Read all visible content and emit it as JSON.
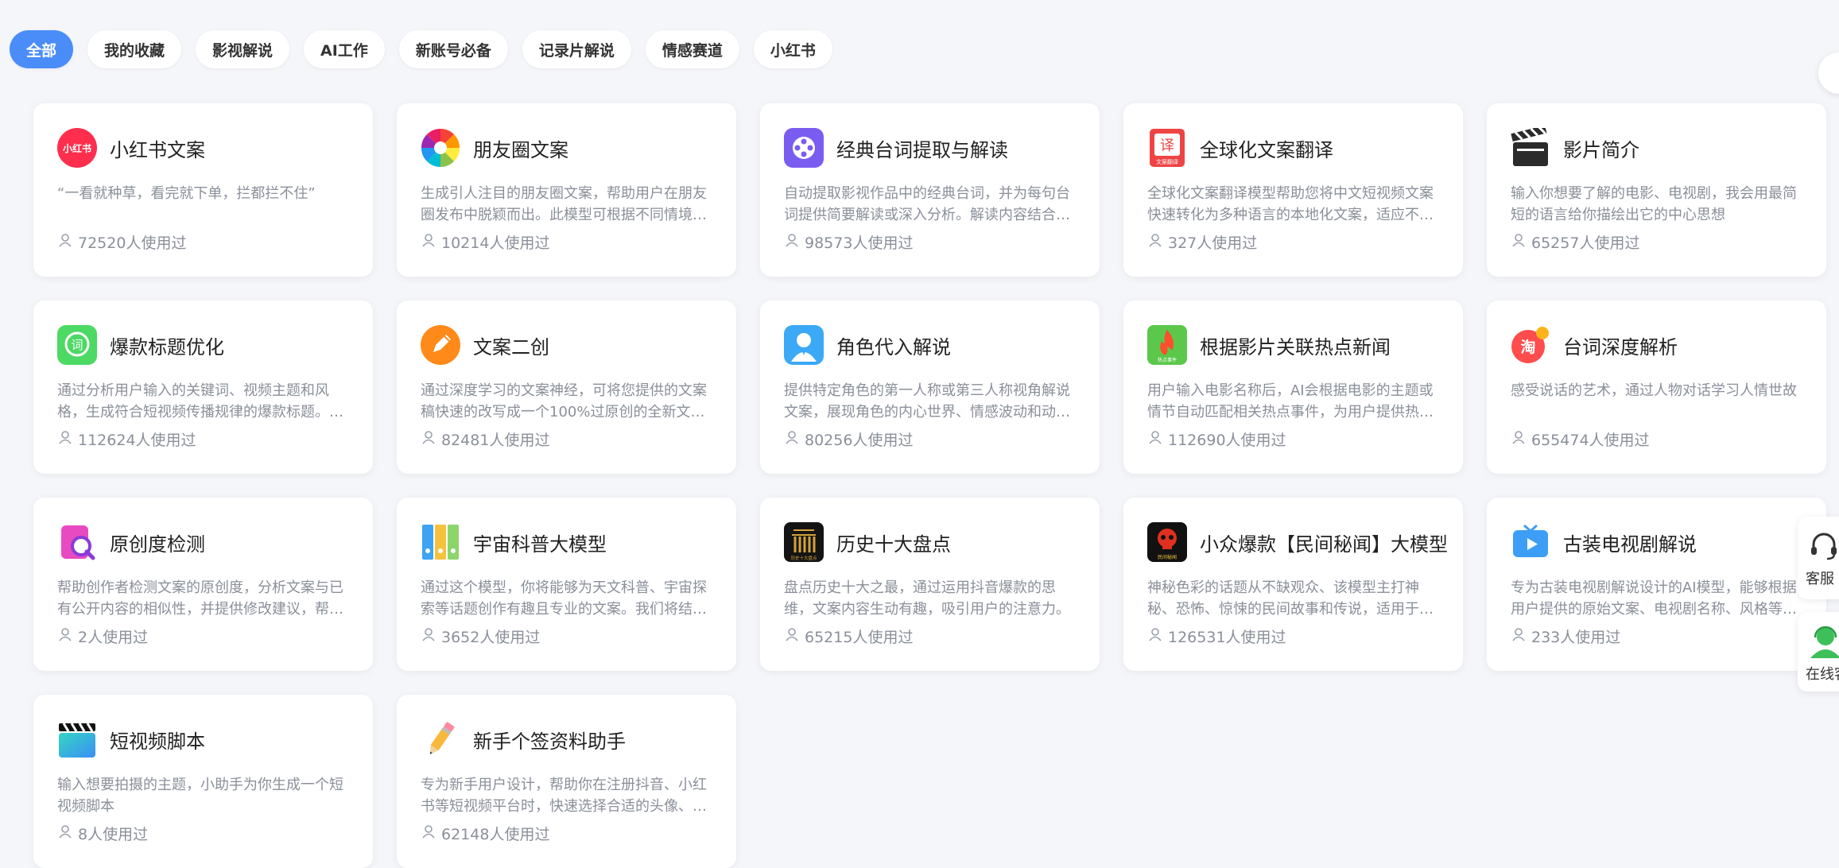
{
  "tabs": [
    "全部",
    "我的收藏",
    "影视解说",
    "AI工作",
    "新账号必备",
    "记录片解说",
    "情感赛道",
    "小红书"
  ],
  "usage_suffix": "人使用过",
  "cards": [
    {
      "title": "小红书文案",
      "desc": "“一看就种草，看完就下单，拦都拦不住”",
      "usage": "72520人使用过",
      "icon": "xiaohongshu-logo-icon",
      "icon_text": "小红书"
    },
    {
      "title": "朋友圈文案",
      "desc": "生成引人注目的朋友圈文案，帮助用户在朋友圈发布中脱颖而出。此模型可根据不同情境和主题，创作出富有创意和吸引力的文案。",
      "usage": "10214人使用过",
      "icon": "camera-aperture-icon"
    },
    {
      "title": "经典台词提取与解读",
      "desc": "自动提取影视作品中的经典台词，并为每句台词提供简要解读或深入分析。解读内容结合剧情与人物背景。",
      "usage": "98573人使用过",
      "icon": "film-reel-icon"
    },
    {
      "title": "全球化文案翻译",
      "desc": "全球化文案翻译模型帮助您将中文短视频文案快速转化为多种语言的本地化文案，适应不同地区受众。",
      "usage": "327人使用过",
      "icon": "translate-book-icon",
      "icon_text": "译",
      "icon_sub": "文案翻译"
    },
    {
      "title": "影片简介",
      "desc": "输入你想要了解的电影、电视剧，我会用最简短的语言给你描绘出它的中心思想",
      "usage": "65257人使用过",
      "icon": "clapperboard-icon"
    },
    {
      "title": "爆款标题优化",
      "desc": "通过分析用户输入的关键词、视频主题和风格，生成符合短视频传播规律的爆款标题。标题更具吸引力。",
      "usage": "112624人使用过",
      "icon": "word-bubble-icon",
      "icon_text": "词"
    },
    {
      "title": "文案二创",
      "desc": "通过深度学习的文案神经，可将您提供的文案稿快速的改写成一个100%过原创的全新文案，保持原意不变。",
      "usage": "82481人使用过",
      "icon": "pencil-circle-icon"
    },
    {
      "title": "角色代入解说",
      "desc": "提供特定角色的第一人称或第三人称视角解说文案，展现角色的内心世界、情感波动和动机变化。",
      "usage": "80256人使用过",
      "icon": "person-avatar-icon"
    },
    {
      "title": "根据影片关联热点新闻",
      "desc": "用户输入电影名称后，AI会根据电影的主题或情节自动匹配相关热点事件，为用户提供热点解说思路。",
      "usage": "112690人使用过",
      "icon": "hot-news-flame-icon",
      "icon_sub": "热点事件"
    },
    {
      "title": "台词深度解析",
      "desc": "感受说话的艺术，通过人物对话学习人情世故",
      "usage": "655474人使用过",
      "icon": "taobao-badge-icon",
      "icon_text": "淘"
    },
    {
      "title": "原创度检测",
      "desc": "帮助创作者检测文案的原创度，分析文案与已有公开内容的相似性，并提供修改建议，帮助提升原创水平。",
      "usage": "2人使用过",
      "icon": "magnifier-document-icon"
    },
    {
      "title": "宇宙科普大模型",
      "desc": "通过这个模型，你将能够为天文科普、宇宙探索等话题创作有趣且专业的文案。我们将结合最新天文知识。",
      "usage": "3652人使用过",
      "icon": "binders-icon"
    },
    {
      "title": "历史十大盘点",
      "desc": "盘点历史十大之最，通过运用抖音爆款的思维，文案内容生动有趣，吸引用户的注意力。",
      "usage": "65215人使用过",
      "icon": "history-ranking-icon",
      "icon_sub": "历史十大盘点"
    },
    {
      "title": "小众爆款【民间秘闻】大模型",
      "desc": "神秘色彩的话题从不缺观众、该模型主打神秘、恐怖、惊悚的民间故事和传说，适用于短视频创作。",
      "usage": "126531人使用过",
      "icon": "folk-secret-skull-icon",
      "icon_sub": "民间秘闻"
    },
    {
      "title": "古装电视剧解说",
      "desc": "专为古装电视剧解说设计的AI模型，能够根据用户提供的原始文案、电视剧名称、风格等信息生成解说。",
      "usage": "233人使用过",
      "icon": "tv-play-icon"
    },
    {
      "title": "短视频脚本",
      "desc": "输入想要拍摄的主题，小助手为你生成一个短视频脚本",
      "usage": "8人使用过",
      "icon": "gradient-clapper-icon"
    },
    {
      "title": "新手个签资料助手",
      "desc": "专为新手用户设计，帮助你在注册抖音、小红书等短视频平台时，快速选择合适的头像、昵称和个性签名。",
      "usage": "62148人使用过",
      "icon": "pencil-icon"
    }
  ],
  "float": {
    "service_label": "客服",
    "online_label": "在线客服"
  },
  "colors": {
    "accent": "#4a8df8",
    "muted": "#8a8f99"
  }
}
